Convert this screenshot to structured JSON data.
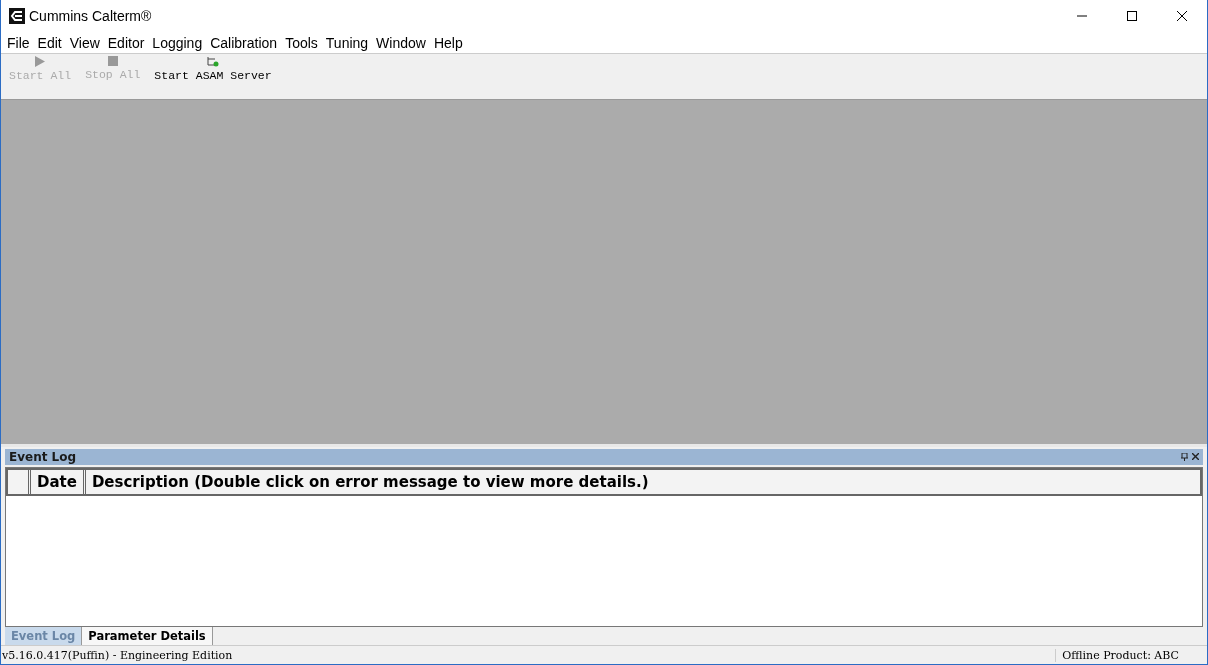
{
  "window": {
    "title": "Cummins Calterm®"
  },
  "menu": [
    "File",
    "Edit",
    "View",
    "Editor",
    "Logging",
    "Calibration",
    "Tools",
    "Tuning",
    "Window",
    "Help"
  ],
  "toolbar": [
    {
      "kind": "play",
      "label": "Start All",
      "disabled": true
    },
    {
      "kind": "stop",
      "label": "Stop All",
      "disabled": true
    },
    {
      "kind": "server",
      "label": "Start ASAM Server",
      "disabled": false
    }
  ],
  "event_log": {
    "title": "Event Log",
    "columns": [
      "Date",
      "Description (Double click on error message to view more details.)"
    ]
  },
  "bottom_tabs": [
    {
      "label": "Event Log",
      "selected": true
    },
    {
      "label": "Parameter Details",
      "selected": false
    }
  ],
  "status_bar": {
    "version": "v5.16.0.417(Puffin) - Engineering Edition",
    "product": "Offline Product: ABC"
  }
}
